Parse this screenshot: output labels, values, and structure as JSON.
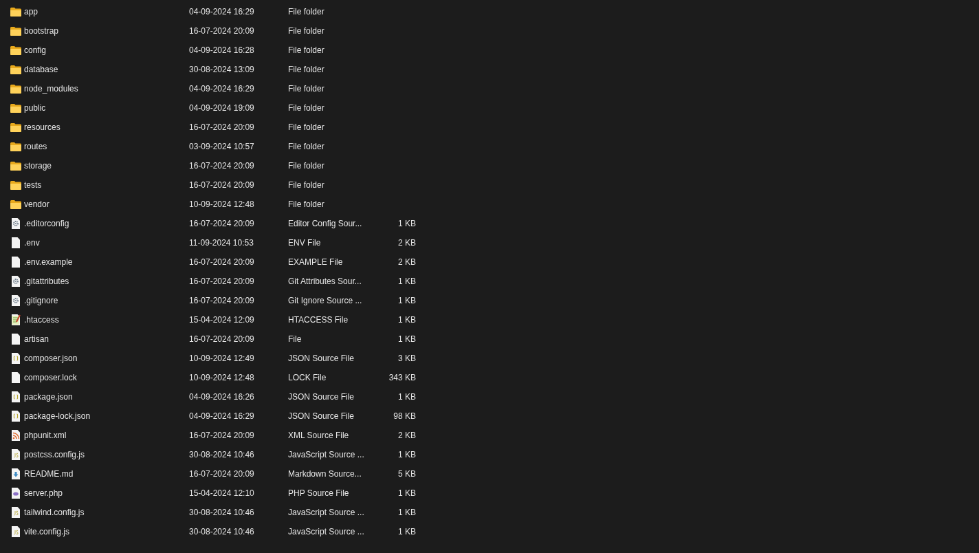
{
  "files": [
    {
      "kind": "folder",
      "name": "app",
      "modified": "04-09-2024 16:29",
      "type": "File folder"
    },
    {
      "kind": "folder",
      "name": "bootstrap",
      "modified": "16-07-2024 20:09",
      "type": "File folder"
    },
    {
      "kind": "folder",
      "name": "config",
      "modified": "04-09-2024 16:28",
      "type": "File folder"
    },
    {
      "kind": "folder",
      "name": "database",
      "modified": "30-08-2024 13:09",
      "type": "File folder"
    },
    {
      "kind": "folder",
      "name": "node_modules",
      "modified": "04-09-2024 16:29",
      "type": "File folder"
    },
    {
      "kind": "folder",
      "name": "public",
      "modified": "04-09-2024 19:09",
      "type": "File folder"
    },
    {
      "kind": "folder",
      "name": "resources",
      "modified": "16-07-2024 20:09",
      "type": "File folder"
    },
    {
      "kind": "folder",
      "name": "routes",
      "modified": "03-09-2024 10:57",
      "type": "File folder"
    },
    {
      "kind": "folder",
      "name": "storage",
      "modified": "16-07-2024 20:09",
      "type": "File folder"
    },
    {
      "kind": "folder",
      "name": "tests",
      "modified": "16-07-2024 20:09",
      "type": "File folder"
    },
    {
      "kind": "folder",
      "name": "vendor",
      "modified": "10-09-2024 12:48",
      "type": "File folder"
    },
    {
      "kind": "config",
      "name": ".editorconfig",
      "modified": "16-07-2024 20:09",
      "type": "Editor Config Sour...",
      "size": "1 KB"
    },
    {
      "kind": "blank",
      "name": ".env",
      "modified": "11-09-2024 10:53",
      "type": "ENV File",
      "size": "2 KB"
    },
    {
      "kind": "blank",
      "name": ".env.example",
      "modified": "16-07-2024 20:09",
      "type": "EXAMPLE File",
      "size": "2 KB"
    },
    {
      "kind": "config",
      "name": ".gitattributes",
      "modified": "16-07-2024 20:09",
      "type": "Git Attributes Sour...",
      "size": "1 KB"
    },
    {
      "kind": "config",
      "name": ".gitignore",
      "modified": "16-07-2024 20:09",
      "type": "Git Ignore Source ...",
      "size": "1 KB"
    },
    {
      "kind": "notepad",
      "name": ".htaccess",
      "modified": "15-04-2024 12:09",
      "type": "HTACCESS File",
      "size": "1 KB"
    },
    {
      "kind": "blank",
      "name": "artisan",
      "modified": "16-07-2024 20:09",
      "type": "File",
      "size": "1 KB"
    },
    {
      "kind": "json",
      "name": "composer.json",
      "modified": "10-09-2024 12:49",
      "type": "JSON Source File",
      "size": "3 KB"
    },
    {
      "kind": "blank",
      "name": "composer.lock",
      "modified": "10-09-2024 12:48",
      "type": "LOCK File",
      "size": "343 KB"
    },
    {
      "kind": "json",
      "name": "package.json",
      "modified": "04-09-2024 16:26",
      "type": "JSON Source File",
      "size": "1 KB"
    },
    {
      "kind": "json",
      "name": "package-lock.json",
      "modified": "04-09-2024 16:29",
      "type": "JSON Source File",
      "size": "98 KB"
    },
    {
      "kind": "xml",
      "name": "phpunit.xml",
      "modified": "16-07-2024 20:09",
      "type": "XML Source File",
      "size": "2 KB"
    },
    {
      "kind": "js",
      "name": "postcss.config.js",
      "modified": "30-08-2024 10:46",
      "type": "JavaScript Source ...",
      "size": "1 KB"
    },
    {
      "kind": "markdown",
      "name": "README.md",
      "modified": "16-07-2024 20:09",
      "type": "Markdown Source...",
      "size": "5 KB"
    },
    {
      "kind": "php",
      "name": "server.php",
      "modified": "15-04-2024 12:10",
      "type": "PHP Source File",
      "size": "1 KB"
    },
    {
      "kind": "js",
      "name": "tailwind.config.js",
      "modified": "30-08-2024 10:46",
      "type": "JavaScript Source ...",
      "size": "1 KB"
    },
    {
      "kind": "js",
      "name": "vite.config.js",
      "modified": "30-08-2024 10:46",
      "type": "JavaScript Source ...",
      "size": "1 KB"
    }
  ]
}
